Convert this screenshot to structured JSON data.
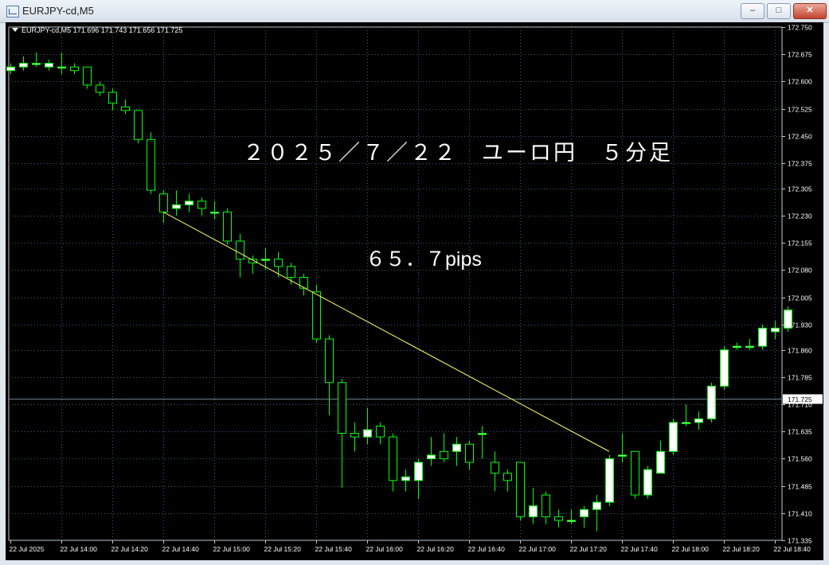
{
  "window": {
    "title": "EURJPY-cd,M5",
    "buttons": {
      "minimize": "–",
      "maximize": "□",
      "close": "✕"
    }
  },
  "header": {
    "info": "EURJPY-cd,M5  171.696 171.743 171.656 171.725"
  },
  "annotations": {
    "title": "２０２５／７／２２　ユーロ円　５分足",
    "pips": "６５．７pips"
  },
  "colors": {
    "background": "#000000",
    "grid": "#3c5a78",
    "candle_outline": "#00ff00",
    "bull_fill": "#ffffff",
    "bear_fill": "#000000",
    "trend_line": "#ffff66",
    "bid_line": "#708090",
    "text": "#ffffff"
  },
  "chart_data": {
    "type": "candlestick",
    "symbol": "EURJPY-cd",
    "timeframe": "M5",
    "ylim": [
      171.335,
      172.75
    ],
    "y_ticks": [
      "172.750",
      "172.675",
      "172.600",
      "172.525",
      "172.450",
      "172.375",
      "172.305",
      "172.230",
      "172.155",
      "172.080",
      "172.005",
      "171.930",
      "171.860",
      "171.785",
      "171.710",
      "171.635",
      "171.560",
      "171.485",
      "171.410",
      "171.335"
    ],
    "x_labels": [
      "22 Jul 2025",
      "22 Jul 14:00",
      "22 Jul 14:20",
      "22 Jul 14:40",
      "22 Jul 15:00",
      "22 Jul 15:20",
      "22 Jul 15:40",
      "22 Jul 16:00",
      "22 Jul 16:20",
      "22 Jul 16:40",
      "22 Jul 17:00",
      "22 Jul 17:20",
      "22 Jul 17:40",
      "22 Jul 18:00",
      "22 Jul 18:20",
      "22 Jul 18:40"
    ],
    "current_price": "171.725",
    "candles": [
      [
        172.63,
        172.64,
        172.65,
        172.62
      ],
      [
        172.64,
        172.65,
        172.67,
        172.63
      ],
      [
        172.65,
        172.65,
        172.68,
        172.64
      ],
      [
        172.64,
        172.65,
        172.66,
        172.63
      ],
      [
        172.64,
        172.64,
        172.68,
        172.62
      ],
      [
        172.64,
        172.63,
        172.65,
        172.62
      ],
      [
        172.64,
        172.59,
        172.64,
        172.58
      ],
      [
        172.59,
        172.57,
        172.6,
        172.56
      ],
      [
        172.57,
        172.54,
        172.58,
        172.52
      ],
      [
        172.53,
        172.52,
        172.55,
        172.51
      ],
      [
        172.52,
        172.44,
        172.52,
        172.43
      ],
      [
        172.44,
        172.3,
        172.46,
        172.29
      ],
      [
        172.29,
        172.24,
        172.3,
        172.21
      ],
      [
        172.25,
        172.26,
        172.3,
        172.23
      ],
      [
        172.26,
        172.27,
        172.29,
        172.24
      ],
      [
        172.27,
        172.25,
        172.28,
        172.23
      ],
      [
        172.24,
        172.24,
        172.27,
        172.22
      ],
      [
        172.24,
        172.16,
        172.25,
        172.15
      ],
      [
        172.16,
        172.11,
        172.18,
        172.06
      ],
      [
        172.11,
        172.1,
        172.12,
        172.07
      ],
      [
        172.11,
        172.11,
        172.14,
        172.08
      ],
      [
        172.11,
        172.09,
        172.13,
        172.06
      ],
      [
        172.09,
        172.06,
        172.1,
        172.04
      ],
      [
        172.06,
        172.03,
        172.07,
        172.01
      ],
      [
        172.02,
        171.89,
        172.04,
        171.88
      ],
      [
        171.89,
        171.77,
        171.9,
        171.68
      ],
      [
        171.77,
        171.63,
        171.78,
        171.48
      ],
      [
        171.63,
        171.62,
        171.66,
        171.58
      ],
      [
        171.62,
        171.64,
        171.7,
        171.6
      ],
      [
        171.65,
        171.62,
        171.66,
        171.6
      ],
      [
        171.62,
        171.5,
        171.63,
        171.47
      ],
      [
        171.5,
        171.51,
        171.53,
        171.47
      ],
      [
        171.5,
        171.55,
        171.56,
        171.45
      ],
      [
        171.56,
        171.57,
        171.62,
        171.54
      ],
      [
        171.58,
        171.56,
        171.63,
        171.55
      ],
      [
        171.58,
        171.6,
        171.62,
        171.54
      ],
      [
        171.6,
        171.55,
        171.61,
        171.53
      ],
      [
        171.63,
        171.63,
        171.65,
        171.56
      ],
      [
        171.55,
        171.52,
        171.58,
        171.47
      ],
      [
        171.52,
        171.5,
        171.53,
        171.47
      ],
      [
        171.55,
        171.4,
        171.55,
        171.39
      ],
      [
        171.4,
        171.43,
        171.48,
        171.38
      ],
      [
        171.46,
        171.4,
        171.47,
        171.38
      ],
      [
        171.4,
        171.39,
        171.42,
        171.37
      ],
      [
        171.39,
        171.39,
        171.42,
        171.38
      ],
      [
        171.4,
        171.42,
        171.43,
        171.37
      ],
      [
        171.42,
        171.44,
        171.46,
        171.36
      ],
      [
        171.44,
        171.56,
        171.57,
        171.43
      ],
      [
        171.57,
        171.57,
        171.63,
        171.55
      ],
      [
        171.58,
        171.46,
        171.58,
        171.45
      ],
      [
        171.46,
        171.53,
        171.54,
        171.45
      ],
      [
        171.52,
        171.58,
        171.61,
        171.52
      ],
      [
        171.58,
        171.66,
        171.67,
        171.57
      ],
      [
        171.66,
        171.66,
        171.71,
        171.65
      ],
      [
        171.66,
        171.67,
        171.69,
        171.64
      ],
      [
        171.67,
        171.76,
        171.77,
        171.66
      ],
      [
        171.76,
        171.86,
        171.87,
        171.75
      ],
      [
        171.87,
        171.87,
        171.88,
        171.86
      ],
      [
        171.87,
        171.87,
        171.89,
        171.86
      ],
      [
        171.87,
        171.92,
        171.93,
        171.86
      ],
      [
        171.91,
        171.92,
        171.94,
        171.89
      ],
      [
        171.92,
        171.97,
        171.98,
        171.91
      ]
    ],
    "trend_line": {
      "from": [
        12,
        172.24
      ],
      "to": [
        47,
        171.58
      ]
    }
  }
}
